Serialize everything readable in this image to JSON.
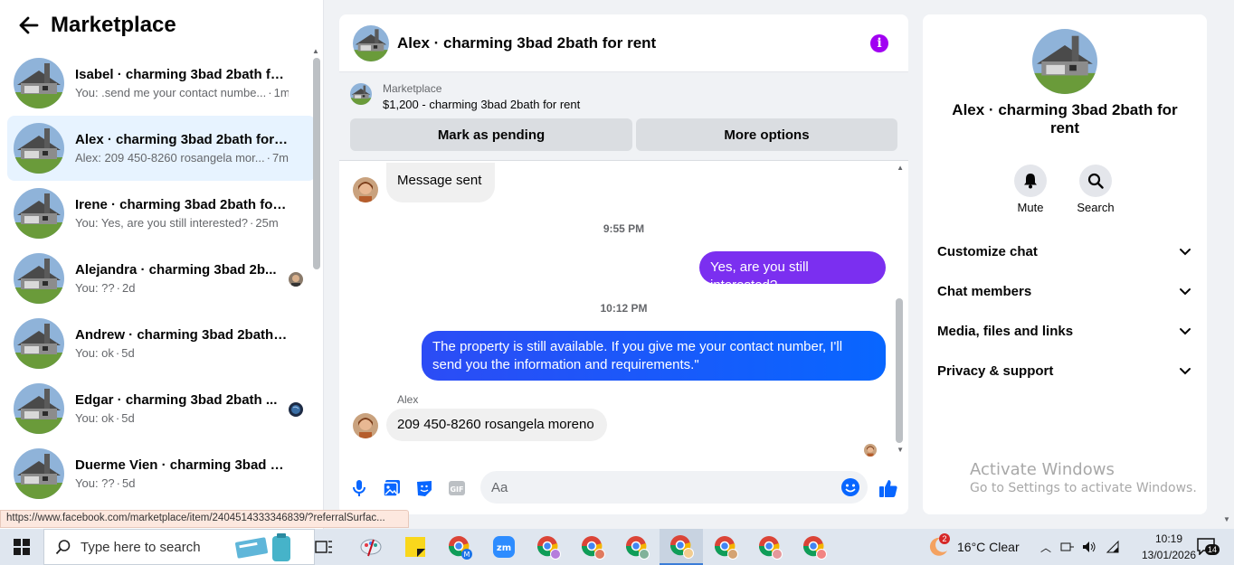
{
  "sidebar": {
    "title": "Marketplace",
    "conversations": [
      {
        "name": "Isabel · charming 3bad 2bath fo...",
        "snippet": "You: .send me your contact numbe...",
        "time": "1m"
      },
      {
        "name": "Alex · charming 3bad 2bath for r...",
        "snippet": "Alex: 209 450-8260 rosangela mor...",
        "time": "7m"
      },
      {
        "name": "Irene · charming 3bad 2bath for ...",
        "snippet": "You: Yes, are you still interested?",
        "time": "25m"
      },
      {
        "name": "Alejandra · charming 3bad 2b...",
        "snippet": "You: ??",
        "time": "2d"
      },
      {
        "name": "Andrew · charming 3bad 2bath f...",
        "snippet": "You: ok",
        "time": "5d"
      },
      {
        "name": "Edgar · charming 3bad 2bath ...",
        "snippet": "You: ok",
        "time": "5d"
      },
      {
        "name": "Duerme Vien · charming 3bad 2...",
        "snippet": "You: ??",
        "time": "5d"
      }
    ],
    "status_url": "https://www.facebook.com/marketplace/item/2404514333346839/?referralSurfac..."
  },
  "chat": {
    "title": "Alex · charming 3bad 2bath for rent",
    "marketplace_label": "Marketplace",
    "listing": "$1,200 - charming 3bad 2bath for rent",
    "mark_pending": "Mark as pending",
    "more_options": "More options",
    "messages": {
      "m1": "Message sent",
      "t1": "9:55 PM",
      "m2": "Yes, are you still interested?",
      "t2": "10:12 PM",
      "m3": "The property is still available. If you give me your contact number, I'll send you the information and requirements.\"",
      "sender": "Alex",
      "m4": "209 450-8260  rosangela moreno"
    },
    "composer_placeholder": "Aa"
  },
  "info_panel": {
    "name": "Alex · charming 3bad 2bath for rent",
    "mute_label": "Mute",
    "search_label": "Search",
    "sections": [
      "Customize chat",
      "Chat members",
      "Media, files and links",
      "Privacy & support"
    ]
  },
  "watermark": {
    "line1": "Activate Windows",
    "line2": "Go to Settings to activate Windows."
  },
  "taskbar": {
    "search_placeholder": "Type here to search",
    "weather": "16°C  Clear",
    "weather_badge": "2",
    "time": "10:19",
    "date": "13/01/2026",
    "notifications": "14"
  },
  "colors": {
    "accent_purple": "#a100f2",
    "outgoing_purple": "#7b2ff0",
    "outgoing_blue": "#0866ff",
    "active_row": "#e7f3ff"
  }
}
